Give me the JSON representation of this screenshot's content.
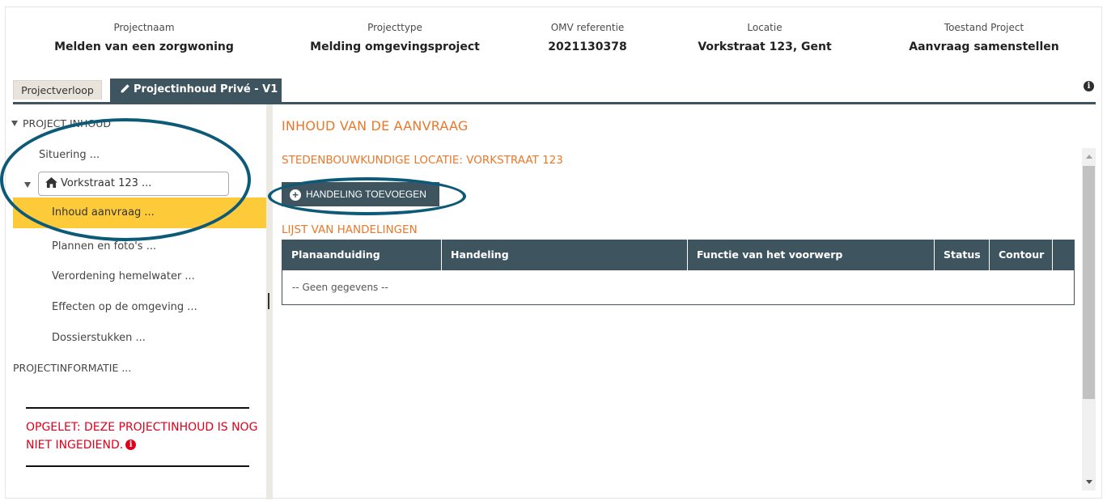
{
  "header": {
    "projectnaam": {
      "label": "Projectnaam",
      "value": "Melden van een zorgwoning"
    },
    "projecttype": {
      "label": "Projecttype",
      "value": "Melding omgevingsproject"
    },
    "omv": {
      "label": "OMV referentie",
      "value": "2021130378"
    },
    "locatie": {
      "label": "Locatie",
      "value": "Vorkstraat 123, Gent"
    },
    "toestand": {
      "label": "Toestand Project",
      "value": "Aanvraag samenstellen"
    }
  },
  "tabs": {
    "projectverloop": "Projectverloop",
    "projectinhoud": "Projectinhoud Privé - V1"
  },
  "info_icon": "i",
  "sidebar": {
    "root": "PROJECT INHOUD",
    "situering": "Situering ...",
    "address": "Vorkstraat 123 ...",
    "items": [
      "Inhoud aanvraag ...",
      "Plannen en foto's ...",
      "Verordening hemelwater ...",
      "Effecten op de omgeving ...",
      "Dossierstukken ..."
    ],
    "projectinformatie": "PROJECTINFORMATIE ...",
    "warning": "OPGELET: DEZE PROJECTINHOUD IS NOG NIET INGEDIEND."
  },
  "main": {
    "title": "INHOUD VAN DE AANVRAAG",
    "location": "STEDENBOUWKUNDIGE LOCATIE: VORKSTRAAT 123",
    "add_button": "HANDELING TOEVOEGEN",
    "list_title": "LIJST VAN HANDELINGEN",
    "table": {
      "columns": [
        "Planaanduiding",
        "Handeling",
        "Functie van het voorwerp",
        "Status",
        "Contour"
      ],
      "empty": "-- Geen gegevens --"
    }
  },
  "colors": {
    "accent": "#e9782b",
    "primary": "#3e5560",
    "highlight": "#fdcb3a",
    "warning": "#e0001b",
    "annotation": "#0d5a78"
  }
}
